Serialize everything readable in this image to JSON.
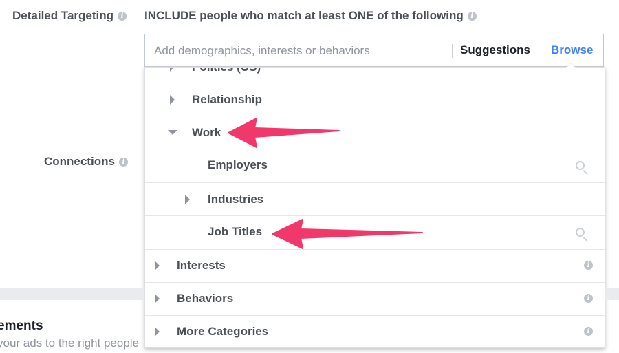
{
  "detailed_targeting": {
    "label": "Detailed Targeting",
    "include_text": "INCLUDE people who match at least ONE of the following",
    "search_placeholder": "Add demographics, interests or behaviors",
    "suggestions_label": "Suggestions",
    "browse_label": "Browse"
  },
  "connections": {
    "label": "Connections"
  },
  "dropdown": {
    "rows": [
      {
        "label": "Politics (US)",
        "expand_state": "collapsed",
        "level": 1
      },
      {
        "label": "Relationship",
        "expand_state": "collapsed",
        "level": 1
      },
      {
        "label": "Work",
        "expand_state": "expanded",
        "level": 1
      },
      {
        "label": "Employers",
        "expand_state": "none",
        "level": 2,
        "icon": "search-icon"
      },
      {
        "label": "Industries",
        "expand_state": "collapsed",
        "level": 2
      },
      {
        "label": "Job Titles",
        "expand_state": "none",
        "level": 2,
        "icon": "search-icon"
      },
      {
        "label": "Interests",
        "expand_state": "collapsed",
        "level": 0,
        "icon": "info-icon"
      },
      {
        "label": "Behaviors",
        "expand_state": "collapsed",
        "level": 0,
        "icon": "info-icon"
      },
      {
        "label": "More Categories",
        "expand_state": "collapsed",
        "level": 0,
        "icon": "info-icon"
      }
    ]
  },
  "placements_section": {
    "title": "ements",
    "description": "your ads to the right people"
  },
  "colors": {
    "accent": "#4080ff",
    "arrow": "#f0386b",
    "text": "#4b4f56"
  }
}
